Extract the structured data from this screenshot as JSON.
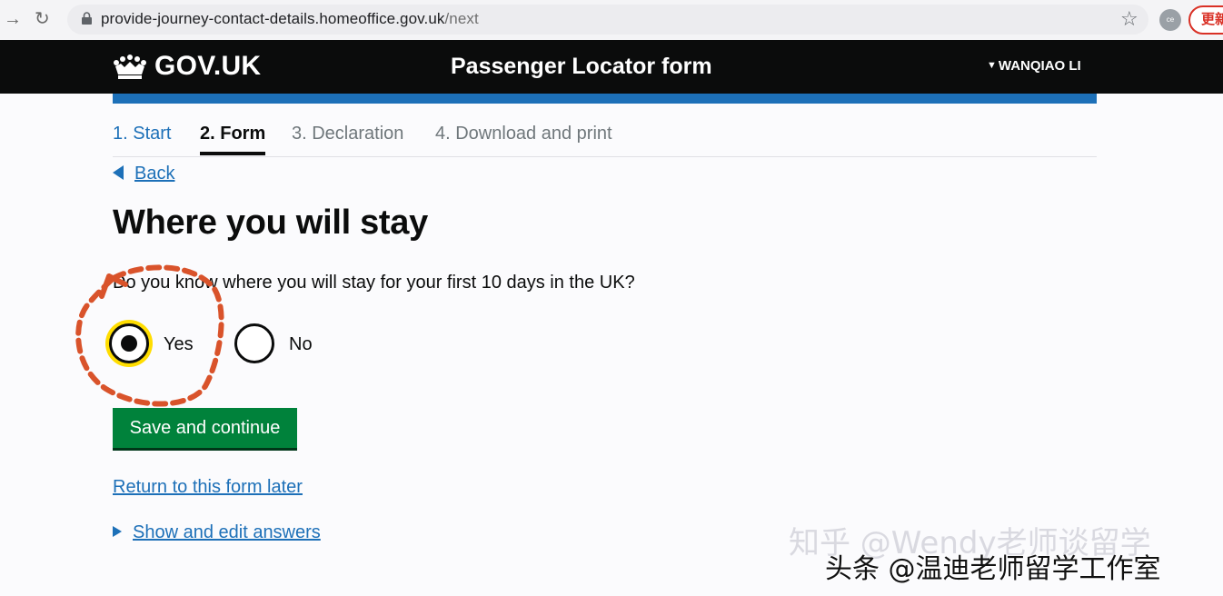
{
  "browser": {
    "url_host": "provide-journey-contact-details.homeoffice.gov.uk",
    "url_path": "/next",
    "profile_initials": "ce",
    "update_label": "更新"
  },
  "header": {
    "logotype": "GOV.UK",
    "service_name": "Passenger Locator form",
    "user_name": "WANQIAO LI"
  },
  "steps": [
    {
      "label": "1. Start",
      "state": "done"
    },
    {
      "label": "2. Form",
      "state": "current"
    },
    {
      "label": "3. Declaration",
      "state": "upcoming"
    },
    {
      "label": "4. Download and print",
      "state": "upcoming"
    }
  ],
  "back_link": "Back",
  "page_title": "Where you will stay",
  "question": "Do you know where you will stay for your first 10 days in the UK?",
  "radios": [
    {
      "label": "Yes",
      "checked": true
    },
    {
      "label": "No",
      "checked": false
    }
  ],
  "save_button": "Save and continue",
  "return_link": "Return to this form later",
  "details_summary": "Show and edit answers",
  "watermarks": {
    "zhihu": "知乎 @Wendy老师谈留学",
    "toutiao": "头条 @温迪老师留学工作室"
  },
  "colors": {
    "header_bg": "#0b0c0c",
    "brand_blue": "#1d70b8",
    "button_green": "#00823b",
    "focus_yellow": "#ffdd00",
    "annotation_red": "#d9532b"
  }
}
